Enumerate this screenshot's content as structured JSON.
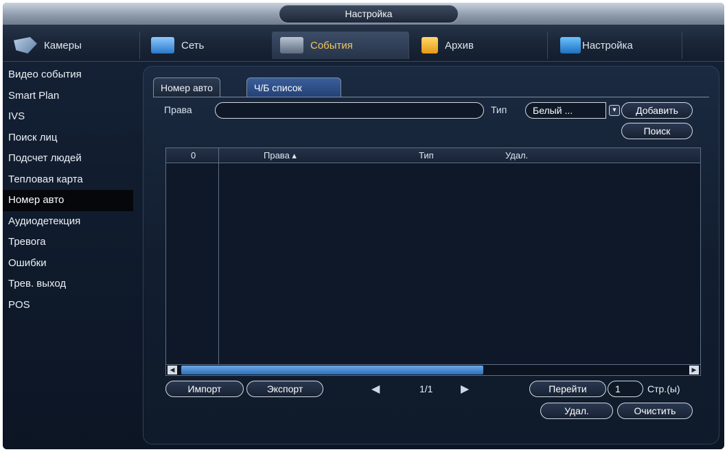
{
  "title": "Настройка",
  "tabs": [
    {
      "label": "Камеры",
      "icon": "camera-icon"
    },
    {
      "label": "Сеть",
      "icon": "network-icon"
    },
    {
      "label": "События",
      "icon": "events-icon"
    },
    {
      "label": "Архив",
      "icon": "archive-icon"
    },
    {
      "label": "Настройка",
      "icon": "settings-icon"
    }
  ],
  "sidebar": {
    "items": [
      "Видео события",
      "Smart Plan",
      "IVS",
      "Поиск лиц",
      "Подсчет людей",
      "Тепловая карта",
      "Номер авто",
      "Аудиодетекция",
      "Тревога",
      "Ошибки",
      "Трев. выход",
      "POS"
    ]
  },
  "subtabs": [
    "Номер авто",
    "Ч/Б список"
  ],
  "filter": {
    "rights_label": "Права",
    "rights_value": "",
    "type_label": "Тип",
    "type_value": "Белый ...",
    "add_button": "Добавить",
    "search_button": "Поиск"
  },
  "table": {
    "headers": [
      "0",
      "Права ▴",
      "Тип",
      "Удал."
    ],
    "rows": []
  },
  "footer": {
    "import_button": "Импорт",
    "export_button": "Экспорт",
    "page": "1/1",
    "goto_button": "Перейти",
    "goto_value": "1",
    "pages_label": "Стр.(ы)",
    "delete_button": "Удал.",
    "clear_button": "Очистить"
  },
  "colors": {
    "accent": "#f2c75a",
    "selected_tab": "#3a5e9b"
  }
}
